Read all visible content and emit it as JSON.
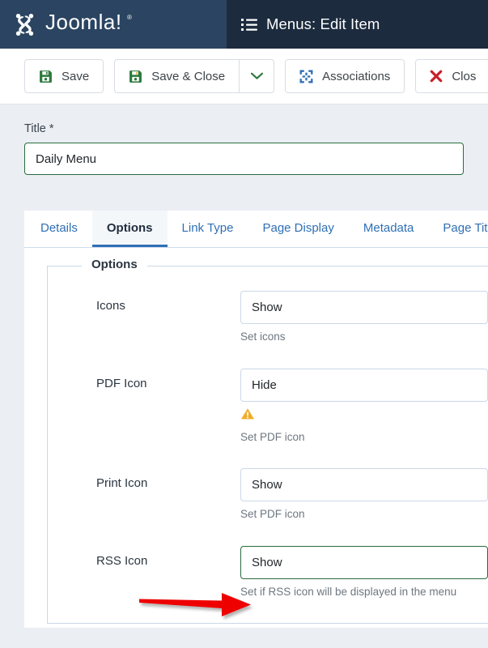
{
  "header": {
    "brand_name": "Joomla!",
    "brand_trademark": "®",
    "title": "Menus: Edit Item",
    "list_icon": "list-icon",
    "brand_bg": "#2a4461",
    "title_bg": "#1c2b3e"
  },
  "toolbar": {
    "buttons": [
      {
        "label": "Save",
        "icon": "floppy-disk-icon",
        "icon_color": "#2d7a3e"
      },
      {
        "label": "Save & Close",
        "icon": "floppy-disk-icon",
        "icon_color": "#2d7a3e"
      },
      {
        "label": "Associations",
        "icon": "associations-icon",
        "icon_color": "#2f6fb5"
      },
      {
        "label": "Clos",
        "icon": "close-x-icon",
        "icon_color": "#c7202a"
      }
    ],
    "dropdown_caret": "chevron-down-icon",
    "caret_color": "#2d7a3e"
  },
  "title_field": {
    "label": "Title *",
    "value": "Daily Menu",
    "border_color": "#2a6b3f"
  },
  "tabs": [
    {
      "label": "Details",
      "active": false
    },
    {
      "label": "Options",
      "active": true
    },
    {
      "label": "Link Type",
      "active": false
    },
    {
      "label": "Page Display",
      "active": false
    },
    {
      "label": "Metadata",
      "active": false
    },
    {
      "label": "Page Titl",
      "active": false
    }
  ],
  "options_fieldset": {
    "legend": "Options",
    "fields": [
      {
        "label": "Icons",
        "value": "Show",
        "description": "Set icons",
        "state": "normal",
        "warning": false
      },
      {
        "label": "PDF Icon",
        "value": "Hide",
        "description": "Set PDF icon",
        "state": "normal",
        "warning": true,
        "warning_icon": "warning-triangle-icon",
        "warning_color": "#f0ad29"
      },
      {
        "label": "Print Icon",
        "value": "Show",
        "description": "Set PDF icon",
        "state": "normal",
        "warning": false
      },
      {
        "label": "RSS Icon",
        "value": "Show",
        "description": "Set if RSS icon will be displayed in the menu",
        "state": "valid",
        "warning": false
      }
    ]
  },
  "annotation": {
    "type": "arrow",
    "color": "#ee0000",
    "points_to": "RSS Icon select",
    "direction": "right"
  }
}
